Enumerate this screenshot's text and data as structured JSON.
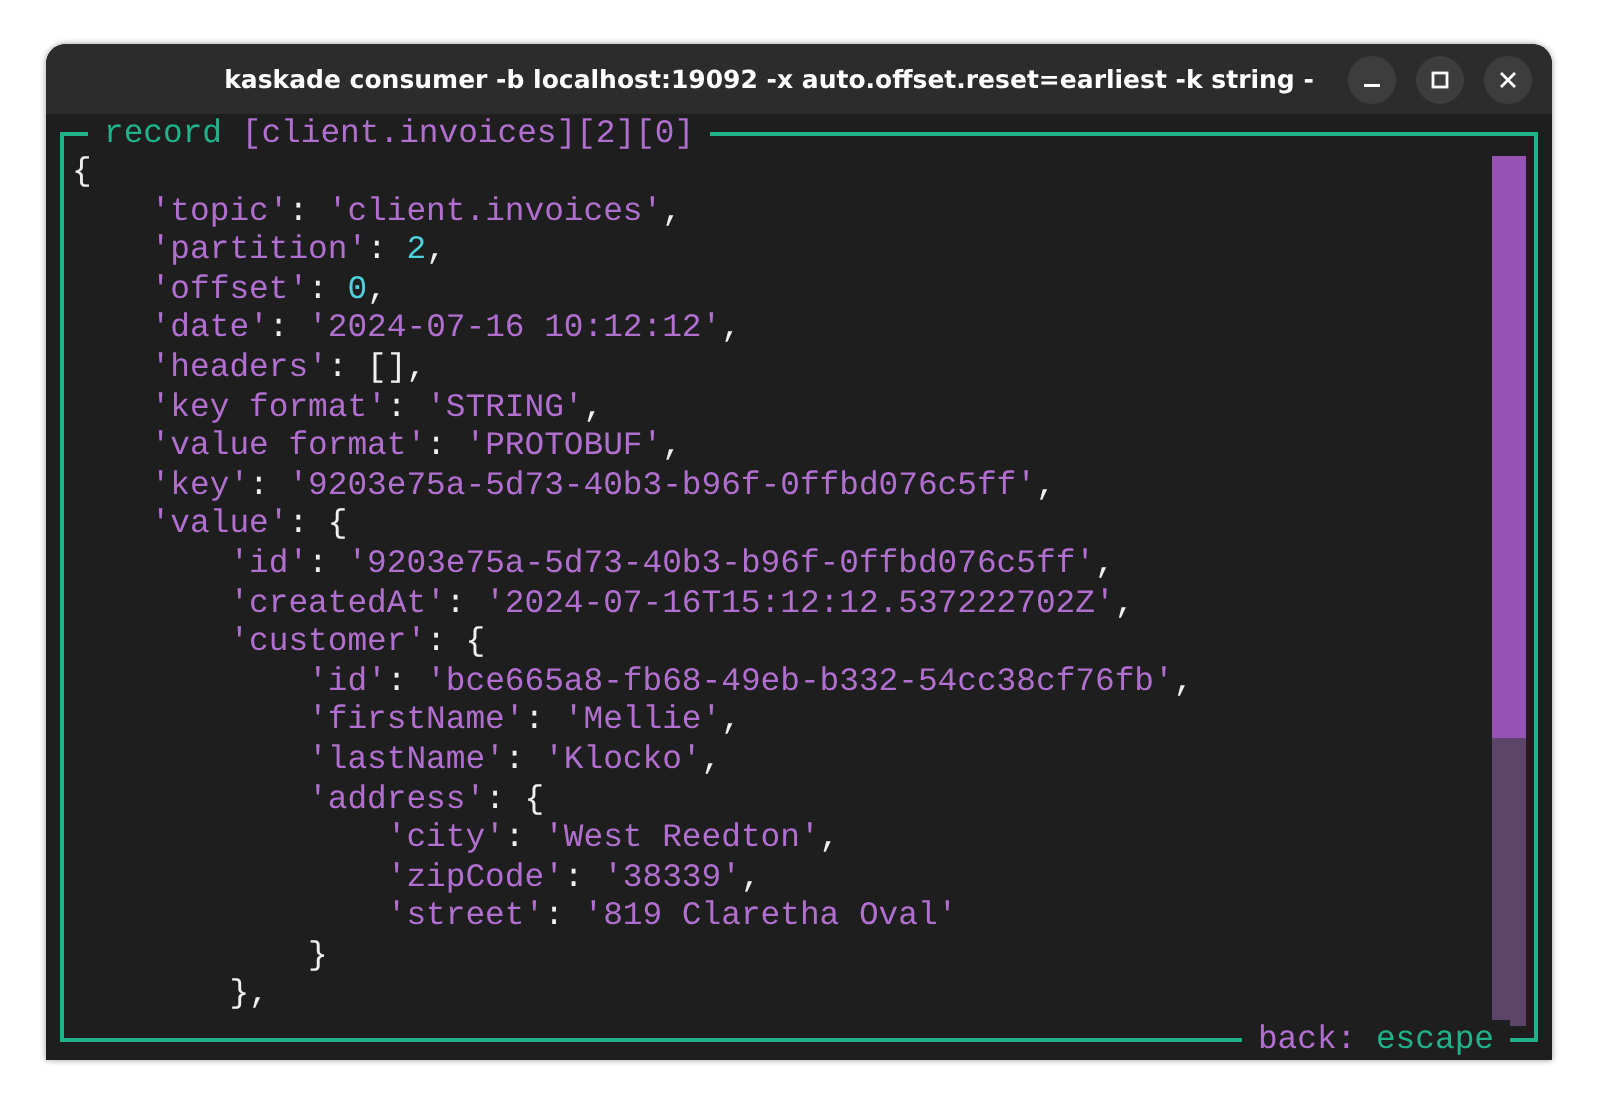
{
  "window": {
    "title": "kaskade consumer -b localhost:19092 -x auto.offset.reset=earliest -k string -"
  },
  "panel": {
    "label": "record",
    "path": "[client.invoices][2][0]"
  },
  "record": {
    "open": "{",
    "entries": [
      {
        "key": "'topic'",
        "colon": ":",
        "kind": "string",
        "value": "'client.invoices'",
        "comma": ","
      },
      {
        "key": "'partition'",
        "colon": ":",
        "kind": "number",
        "value": "2",
        "comma": ","
      },
      {
        "key": "'offset'",
        "colon": ":",
        "kind": "number",
        "value": "0",
        "comma": ","
      },
      {
        "key": "'date'",
        "colon": ":",
        "kind": "string",
        "value": "'2024-07-16 10:12:12'",
        "comma": ","
      },
      {
        "key": "'headers'",
        "colon": ":",
        "kind": "list",
        "value": "[]",
        "comma": ","
      },
      {
        "key": "'key format'",
        "colon": ":",
        "kind": "string",
        "value": "'STRING'",
        "comma": ","
      },
      {
        "key": "'value format'",
        "colon": ":",
        "kind": "string",
        "value": "'PROTOBUF'",
        "comma": ","
      },
      {
        "key": "'key'",
        "colon": ":",
        "kind": "string",
        "value": "'9203e75a-5d73-40b3-b96f-0ffbd076c5ff'",
        "comma": ","
      },
      {
        "key": "'value'",
        "colon": ":",
        "kind": "object",
        "value": "{",
        "children": [
          {
            "key": "'id'",
            "colon": ":",
            "kind": "string",
            "value": "'9203e75a-5d73-40b3-b96f-0ffbd076c5ff'",
            "comma": ","
          },
          {
            "key": "'createdAt'",
            "colon": ":",
            "kind": "string",
            "value": "'2024-07-16T15:12:12.537222702Z'",
            "comma": ","
          },
          {
            "key": "'customer'",
            "colon": ":",
            "kind": "object",
            "value": "{",
            "close": "},",
            "children": [
              {
                "key": "'id'",
                "colon": ":",
                "kind": "string",
                "value": "'bce665a8-fb68-49eb-b332-54cc38cf76fb'",
                "comma": ","
              },
              {
                "key": "'firstName'",
                "colon": ":",
                "kind": "string",
                "value": "'Mellie'",
                "comma": ","
              },
              {
                "key": "'lastName'",
                "colon": ":",
                "kind": "string",
                "value": "'Klocko'",
                "comma": ","
              },
              {
                "key": "'address'",
                "colon": ":",
                "kind": "object",
                "value": "{",
                "close": "}",
                "children": [
                  {
                    "key": "'city'",
                    "colon": ":",
                    "kind": "string",
                    "value": "'West Reedton'",
                    "comma": ","
                  },
                  {
                    "key": "'zipCode'",
                    "colon": ":",
                    "kind": "string",
                    "value": "'38339'",
                    "comma": ","
                  },
                  {
                    "key": "'street'",
                    "colon": ":",
                    "kind": "string",
                    "value": "'819 Claretha Oval'"
                  }
                ]
              }
            ]
          }
        ]
      }
    ]
  },
  "footer": {
    "label": "back:",
    "key": "escape"
  }
}
